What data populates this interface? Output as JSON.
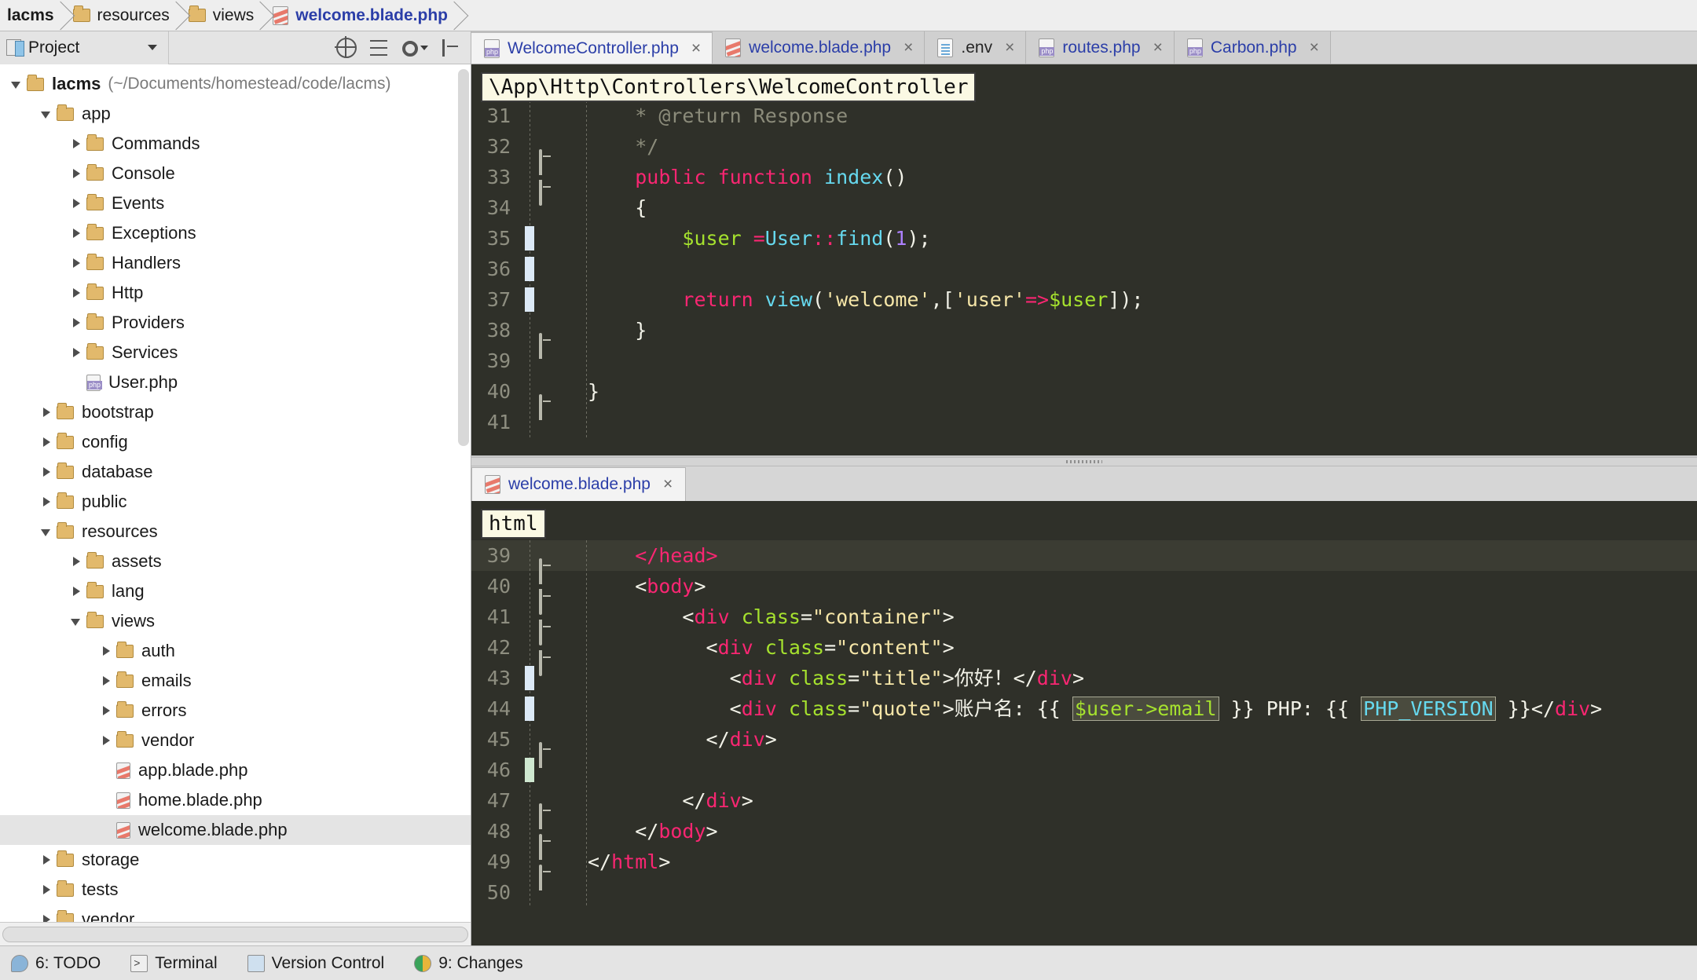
{
  "breadcrumb": [
    {
      "label": "lacms",
      "icon": "none",
      "style": "bold"
    },
    {
      "label": "resources",
      "icon": "folder-icon",
      "style": "normal"
    },
    {
      "label": "views",
      "icon": "folder-icon",
      "style": "normal"
    },
    {
      "label": "welcome.blade.php",
      "icon": "blade-file-icon",
      "style": "link-bold"
    }
  ],
  "project_panel": {
    "title": "Project",
    "tools": [
      "locate-icon",
      "collapse-all-icon",
      "settings-gear-icon",
      "hide-panel-icon"
    ],
    "tree": [
      {
        "label": "lacms",
        "sub": "(~/Documents/homestead/code/lacms)",
        "icon": "folder-icon",
        "arrow": "open",
        "indent": 0,
        "bold": true,
        "selected": false
      },
      {
        "label": "app",
        "sub": "",
        "icon": "folder-icon",
        "arrow": "open",
        "indent": 1,
        "bold": false,
        "selected": false
      },
      {
        "label": "Commands",
        "sub": "",
        "icon": "folder-icon",
        "arrow": "closed",
        "indent": 2,
        "bold": false,
        "selected": false
      },
      {
        "label": "Console",
        "sub": "",
        "icon": "folder-icon",
        "arrow": "closed",
        "indent": 2,
        "bold": false,
        "selected": false
      },
      {
        "label": "Events",
        "sub": "",
        "icon": "folder-icon",
        "arrow": "closed",
        "indent": 2,
        "bold": false,
        "selected": false
      },
      {
        "label": "Exceptions",
        "sub": "",
        "icon": "folder-icon",
        "arrow": "closed",
        "indent": 2,
        "bold": false,
        "selected": false
      },
      {
        "label": "Handlers",
        "sub": "",
        "icon": "folder-icon",
        "arrow": "closed",
        "indent": 2,
        "bold": false,
        "selected": false
      },
      {
        "label": "Http",
        "sub": "",
        "icon": "folder-icon",
        "arrow": "closed",
        "indent": 2,
        "bold": false,
        "selected": false
      },
      {
        "label": "Providers",
        "sub": "",
        "icon": "folder-icon",
        "arrow": "closed",
        "indent": 2,
        "bold": false,
        "selected": false
      },
      {
        "label": "Services",
        "sub": "",
        "icon": "folder-icon",
        "arrow": "closed",
        "indent": 2,
        "bold": false,
        "selected": false
      },
      {
        "label": "User.php",
        "sub": "",
        "icon": "php-file-icon",
        "arrow": "none",
        "indent": 2,
        "bold": false,
        "selected": false
      },
      {
        "label": "bootstrap",
        "sub": "",
        "icon": "folder-icon",
        "arrow": "closed",
        "indent": 1,
        "bold": false,
        "selected": false
      },
      {
        "label": "config",
        "sub": "",
        "icon": "folder-icon",
        "arrow": "closed",
        "indent": 1,
        "bold": false,
        "selected": false
      },
      {
        "label": "database",
        "sub": "",
        "icon": "folder-icon",
        "arrow": "closed",
        "indent": 1,
        "bold": false,
        "selected": false
      },
      {
        "label": "public",
        "sub": "",
        "icon": "folder-icon",
        "arrow": "closed",
        "indent": 1,
        "bold": false,
        "selected": false
      },
      {
        "label": "resources",
        "sub": "",
        "icon": "folder-icon",
        "arrow": "open",
        "indent": 1,
        "bold": false,
        "selected": false
      },
      {
        "label": "assets",
        "sub": "",
        "icon": "folder-icon",
        "arrow": "closed",
        "indent": 2,
        "bold": false,
        "selected": false
      },
      {
        "label": "lang",
        "sub": "",
        "icon": "folder-icon",
        "arrow": "closed",
        "indent": 2,
        "bold": false,
        "selected": false
      },
      {
        "label": "views",
        "sub": "",
        "icon": "folder-icon",
        "arrow": "open",
        "indent": 2,
        "bold": false,
        "selected": false
      },
      {
        "label": "auth",
        "sub": "",
        "icon": "folder-icon",
        "arrow": "closed",
        "indent": 3,
        "bold": false,
        "selected": false
      },
      {
        "label": "emails",
        "sub": "",
        "icon": "folder-icon",
        "arrow": "closed",
        "indent": 3,
        "bold": false,
        "selected": false
      },
      {
        "label": "errors",
        "sub": "",
        "icon": "folder-icon",
        "arrow": "closed",
        "indent": 3,
        "bold": false,
        "selected": false
      },
      {
        "label": "vendor",
        "sub": "",
        "icon": "folder-icon",
        "arrow": "closed",
        "indent": 3,
        "bold": false,
        "selected": false
      },
      {
        "label": "app.blade.php",
        "sub": "",
        "icon": "blade-file-icon",
        "arrow": "none",
        "indent": 3,
        "bold": false,
        "selected": false
      },
      {
        "label": "home.blade.php",
        "sub": "",
        "icon": "blade-file-icon",
        "arrow": "none",
        "indent": 3,
        "bold": false,
        "selected": false
      },
      {
        "label": "welcome.blade.php",
        "sub": "",
        "icon": "blade-file-icon",
        "arrow": "none",
        "indent": 3,
        "bold": false,
        "selected": true
      },
      {
        "label": "storage",
        "sub": "",
        "icon": "folder-icon",
        "arrow": "closed",
        "indent": 1,
        "bold": false,
        "selected": false
      },
      {
        "label": "tests",
        "sub": "",
        "icon": "folder-icon",
        "arrow": "closed",
        "indent": 1,
        "bold": false,
        "selected": false
      },
      {
        "label": "vendor",
        "sub": "",
        "icon": "folder-icon",
        "arrow": "closed",
        "indent": 1,
        "bold": false,
        "selected": false
      }
    ]
  },
  "editor_tabs": [
    {
      "label": "WelcomeController.php",
      "icon": "php-file-icon",
      "active": true,
      "close": "×"
    },
    {
      "label": "welcome.blade.php",
      "icon": "blade-file-icon",
      "active": false,
      "close": "×"
    },
    {
      "label": ".env",
      "icon": "env-file-icon",
      "active": false,
      "close": "×"
    },
    {
      "label": "routes.php",
      "icon": "php-file-icon",
      "active": false,
      "close": "×"
    },
    {
      "label": "Carbon.php",
      "icon": "php-file-icon",
      "active": false,
      "close": "×"
    }
  ],
  "top_editor": {
    "breadcrumb_chip": "\\App\\Http\\Controllers\\WelcomeController",
    "first_line": 31,
    "lines": [
      {
        "n": 31,
        "fold": "none",
        "change": "none",
        "tokens": [
          {
            "t": "    ",
            "c": "c-txt"
          },
          {
            "t": "* @return Response",
            "c": "c-com"
          }
        ]
      },
      {
        "n": 32,
        "fold": "up",
        "change": "none",
        "tokens": [
          {
            "t": "    ",
            "c": "c-txt"
          },
          {
            "t": "*/",
            "c": "c-com"
          }
        ]
      },
      {
        "n": 33,
        "fold": "down",
        "change": "none",
        "tokens": [
          {
            "t": "    ",
            "c": "c-txt"
          },
          {
            "t": "public function ",
            "c": "c-kw"
          },
          {
            "t": "index",
            "c": "c-fn"
          },
          {
            "t": "()",
            "c": "c-pun"
          }
        ]
      },
      {
        "n": 34,
        "fold": "none",
        "change": "none",
        "tokens": [
          {
            "t": "    {",
            "c": "c-pun"
          }
        ]
      },
      {
        "n": 35,
        "fold": "none",
        "change": "blue",
        "tokens": [
          {
            "t": "        ",
            "c": "c-txt"
          },
          {
            "t": "$user ",
            "c": "c-var"
          },
          {
            "t": "=",
            "c": "c-kw"
          },
          {
            "t": "User",
            "c": "c-fn"
          },
          {
            "t": "::",
            "c": "c-kw"
          },
          {
            "t": "find",
            "c": "c-fn"
          },
          {
            "t": "(",
            "c": "c-pun"
          },
          {
            "t": "1",
            "c": "c-num"
          },
          {
            "t": ");",
            "c": "c-pun"
          }
        ]
      },
      {
        "n": 36,
        "fold": "none",
        "change": "blue",
        "tokens": [
          {
            "t": "",
            "c": "c-txt"
          }
        ]
      },
      {
        "n": 37,
        "fold": "none",
        "change": "blue",
        "tokens": [
          {
            "t": "        ",
            "c": "c-txt"
          },
          {
            "t": "return ",
            "c": "c-kw"
          },
          {
            "t": "view",
            "c": "c-fn"
          },
          {
            "t": "(",
            "c": "c-pun"
          },
          {
            "t": "'welcome'",
            "c": "c-str"
          },
          {
            "t": ",[",
            "c": "c-pun"
          },
          {
            "t": "'user'",
            "c": "c-str"
          },
          {
            "t": "=>",
            "c": "c-kw"
          },
          {
            "t": "$user",
            "c": "c-var"
          },
          {
            "t": "]);",
            "c": "c-pun"
          }
        ]
      },
      {
        "n": 38,
        "fold": "up",
        "change": "none",
        "tokens": [
          {
            "t": "    }",
            "c": "c-pun"
          }
        ]
      },
      {
        "n": 39,
        "fold": "none",
        "change": "none",
        "tokens": [
          {
            "t": "",
            "c": "c-txt"
          }
        ]
      },
      {
        "n": 40,
        "fold": "up",
        "change": "none",
        "tokens": [
          {
            "t": "}",
            "c": "c-pun"
          }
        ]
      },
      {
        "n": 41,
        "fold": "none",
        "change": "none",
        "tokens": [
          {
            "t": "",
            "c": "c-txt"
          }
        ]
      }
    ]
  },
  "bottom_editor": {
    "tab_label": "welcome.blade.php",
    "tab_close": "×",
    "breadcrumb_chip": "html",
    "lines": [
      {
        "n": 39,
        "fold": "up",
        "change": "none",
        "hl": true,
        "tokens": [
          {
            "t": "    ",
            "c": "c-txt"
          },
          {
            "t": "</head>",
            "c": "c-tag"
          }
        ]
      },
      {
        "n": 40,
        "fold": "down",
        "change": "none",
        "hl": false,
        "tokens": [
          {
            "t": "    ",
            "c": "c-txt"
          },
          {
            "t": "<",
            "c": "c-txt"
          },
          {
            "t": "body",
            "c": "c-tag"
          },
          {
            "t": ">",
            "c": "c-txt"
          }
        ]
      },
      {
        "n": 41,
        "fold": "down",
        "change": "none",
        "hl": false,
        "tokens": [
          {
            "t": "        ",
            "c": "c-txt"
          },
          {
            "t": "<",
            "c": "c-txt"
          },
          {
            "t": "div ",
            "c": "c-tag"
          },
          {
            "t": "class",
            "c": "c-att"
          },
          {
            "t": "=",
            "c": "c-txt"
          },
          {
            "t": "\"container\"",
            "c": "c-str"
          },
          {
            "t": ">",
            "c": "c-txt"
          }
        ]
      },
      {
        "n": 42,
        "fold": "down",
        "change": "none",
        "hl": false,
        "tokens": [
          {
            "t": "          ",
            "c": "c-txt"
          },
          {
            "t": "<",
            "c": "c-txt"
          },
          {
            "t": "div ",
            "c": "c-tag"
          },
          {
            "t": "class",
            "c": "c-att"
          },
          {
            "t": "=",
            "c": "c-txt"
          },
          {
            "t": "\"content\"",
            "c": "c-str"
          },
          {
            "t": ">",
            "c": "c-txt"
          }
        ]
      },
      {
        "n": 43,
        "fold": "none",
        "change": "blue",
        "hl": false,
        "tokens": [
          {
            "t": "            ",
            "c": "c-txt"
          },
          {
            "t": "<",
            "c": "c-txt"
          },
          {
            "t": "div ",
            "c": "c-tag"
          },
          {
            "t": "class",
            "c": "c-att"
          },
          {
            "t": "=",
            "c": "c-txt"
          },
          {
            "t": "\"title\"",
            "c": "c-str"
          },
          {
            "t": ">",
            "c": "c-txt"
          },
          {
            "t": "你好！",
            "c": "c-txt"
          },
          {
            "t": "</",
            "c": "c-txt"
          },
          {
            "t": "div",
            "c": "c-tag"
          },
          {
            "t": ">",
            "c": "c-txt"
          }
        ]
      },
      {
        "n": 44,
        "fold": "none",
        "change": "blue",
        "hl": false,
        "tokens": [
          {
            "t": "            ",
            "c": "c-txt"
          },
          {
            "t": "<",
            "c": "c-txt"
          },
          {
            "t": "div ",
            "c": "c-tag"
          },
          {
            "t": "class",
            "c": "c-att"
          },
          {
            "t": "=",
            "c": "c-txt"
          },
          {
            "t": "\"quote\"",
            "c": "c-str"
          },
          {
            "t": ">",
            "c": "c-txt"
          },
          {
            "t": "账户名: {{ ",
            "c": "c-txt"
          },
          {
            "t": "$user->email",
            "c": "c-var",
            "box": true
          },
          {
            "t": " }} PHP: {{ ",
            "c": "c-txt"
          },
          {
            "t": "PHP_VERSION",
            "c": "c-fn",
            "box": true
          },
          {
            "t": " }}",
            "c": "c-txt"
          },
          {
            "t": "</",
            "c": "c-txt"
          },
          {
            "t": "div",
            "c": "c-tag"
          },
          {
            "t": ">",
            "c": "c-txt"
          }
        ]
      },
      {
        "n": 45,
        "fold": "up",
        "change": "none",
        "hl": false,
        "tokens": [
          {
            "t": "          ",
            "c": "c-txt"
          },
          {
            "t": "</",
            "c": "c-txt"
          },
          {
            "t": "div",
            "c": "c-tag"
          },
          {
            "t": ">",
            "c": "c-txt"
          }
        ]
      },
      {
        "n": 46,
        "fold": "none",
        "change": "green",
        "hl": false,
        "tokens": [
          {
            "t": "",
            "c": "c-txt"
          }
        ]
      },
      {
        "n": 47,
        "fold": "up",
        "change": "none",
        "hl": false,
        "tokens": [
          {
            "t": "        ",
            "c": "c-txt"
          },
          {
            "t": "</",
            "c": "c-txt"
          },
          {
            "t": "div",
            "c": "c-tag"
          },
          {
            "t": ">",
            "c": "c-txt"
          }
        ]
      },
      {
        "n": 48,
        "fold": "up",
        "change": "none",
        "hl": false,
        "tokens": [
          {
            "t": "    ",
            "c": "c-txt"
          },
          {
            "t": "</",
            "c": "c-txt"
          },
          {
            "t": "body",
            "c": "c-tag"
          },
          {
            "t": ">",
            "c": "c-txt"
          }
        ]
      },
      {
        "n": 49,
        "fold": "up",
        "change": "none",
        "hl": false,
        "tokens": [
          {
            "t": "",
            "c": "c-txt"
          },
          {
            "t": "</",
            "c": "c-txt"
          },
          {
            "t": "html",
            "c": "c-tag"
          },
          {
            "t": ">",
            "c": "c-txt"
          }
        ]
      },
      {
        "n": 50,
        "fold": "none",
        "change": "none",
        "hl": false,
        "tokens": [
          {
            "t": "",
            "c": "c-txt"
          }
        ]
      }
    ]
  },
  "status_bar": [
    {
      "label": "6: TODO",
      "icon": "todo-icon"
    },
    {
      "label": "Terminal",
      "icon": "terminal-icon"
    },
    {
      "label": "Version Control",
      "icon": "version-control-icon"
    },
    {
      "label": "9: Changes",
      "icon": "changes-icon"
    }
  ],
  "colors": {
    "editor_bg": "#2f3029",
    "keyword": "#f92672",
    "function": "#66d9ef",
    "variable": "#a6e22e",
    "string": "#f6e6a8",
    "number": "#ae81ff",
    "comment": "#8b8b7a",
    "link": "#2b3ea8",
    "panel_bg": "#e4e4e4"
  }
}
